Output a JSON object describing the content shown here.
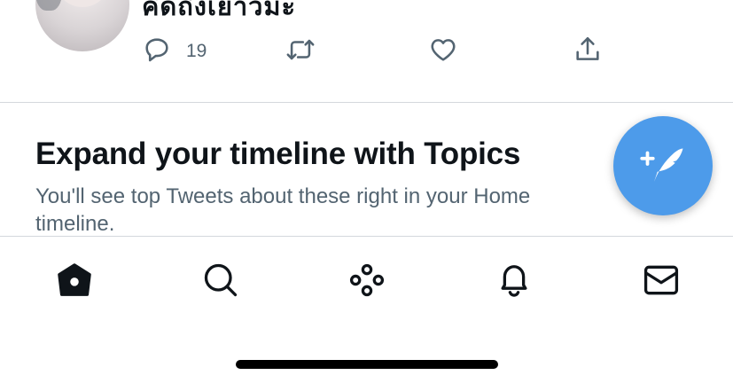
{
  "tweet": {
    "text": "คิดถึงเยาวมะ",
    "reply_count": "19"
  },
  "topics_prompt": {
    "title": "Expand your timeline with Topics",
    "subtitle": "You'll see top Tweets about these right in your Home timeline."
  },
  "colors": {
    "accent": "#4d9bea",
    "text_primary": "#0f1419",
    "text_secondary": "#536471"
  },
  "icons": {
    "reply": "reply-icon",
    "retweet": "retweet-icon",
    "like": "heart-icon",
    "share": "share-icon",
    "compose": "compose-tweet-icon",
    "home": "home-icon",
    "search": "search-icon",
    "spaces": "spaces-icon",
    "notifications": "bell-icon",
    "messages": "mail-icon"
  }
}
